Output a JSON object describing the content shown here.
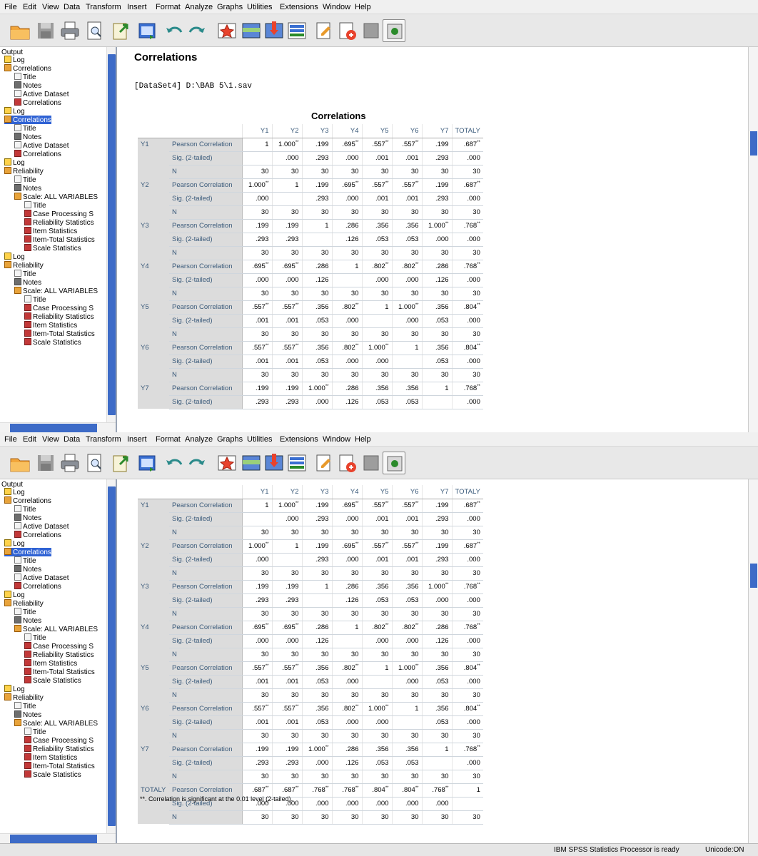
{
  "menu": [
    "File",
    "Edit",
    "View",
    "Data",
    "Transform",
    "Insert",
    "Format",
    "Analyze",
    "Graphs",
    "Utilities",
    "Extensions",
    "Window",
    "Help"
  ],
  "toolbar_icons": [
    "open-icon",
    "save-icon",
    "print-icon",
    "print-preview-icon",
    "export-icon",
    "recall-dialog-icon",
    "undo-icon",
    "redo-icon",
    "goto-data-icon",
    "goto-case-icon",
    "goto-variable-icon",
    "variables-icon",
    "insert-output-icon",
    "designate-window-icon",
    "hide-icon",
    "show-icon"
  ],
  "nav": {
    "root": "Output",
    "items": [
      {
        "label": "Log",
        "icon": "book",
        "level": 0
      },
      {
        "label": "Correlations",
        "icon": "folder",
        "level": 0
      },
      {
        "label": "Title",
        "icon": "doc",
        "level": 1
      },
      {
        "label": "Notes",
        "icon": "notes",
        "level": 1
      },
      {
        "label": "Active Dataset",
        "icon": "doc",
        "level": 1
      },
      {
        "label": "Correlations",
        "icon": "table",
        "level": 1
      },
      {
        "label": "Log",
        "icon": "book",
        "level": 0
      },
      {
        "label": "Correlations",
        "icon": "folder",
        "level": 0,
        "selected": true
      },
      {
        "label": "Title",
        "icon": "doc",
        "level": 1
      },
      {
        "label": "Notes",
        "icon": "notes",
        "level": 1
      },
      {
        "label": "Active Dataset",
        "icon": "doc",
        "level": 1
      },
      {
        "label": "Correlations",
        "icon": "table",
        "level": 1
      },
      {
        "label": "Log",
        "icon": "book",
        "level": 0
      },
      {
        "label": "Reliability",
        "icon": "folder",
        "level": 0
      },
      {
        "label": "Title",
        "icon": "doc",
        "level": 1
      },
      {
        "label": "Notes",
        "icon": "notes",
        "level": 1
      },
      {
        "label": "Scale: ALL VARIABLES",
        "icon": "folder",
        "level": 1
      },
      {
        "label": "Title",
        "icon": "doc",
        "level": 2
      },
      {
        "label": "Case Processing S",
        "icon": "table",
        "level": 2
      },
      {
        "label": "Reliability Statistics",
        "icon": "table",
        "level": 2
      },
      {
        "label": "Item Statistics",
        "icon": "table",
        "level": 2
      },
      {
        "label": "Item-Total Statistics",
        "icon": "table",
        "level": 2
      },
      {
        "label": "Scale Statistics",
        "icon": "table",
        "level": 2
      },
      {
        "label": "Log",
        "icon": "book",
        "level": 0
      },
      {
        "label": "Reliability",
        "icon": "folder",
        "level": 0
      },
      {
        "label": "Title",
        "icon": "doc",
        "level": 1
      },
      {
        "label": "Notes",
        "icon": "notes",
        "level": 1
      },
      {
        "label": "Scale: ALL VARIABLES",
        "icon": "folder",
        "level": 1
      },
      {
        "label": "Title",
        "icon": "doc",
        "level": 2
      },
      {
        "label": "Case Processing S",
        "icon": "table",
        "level": 2
      },
      {
        "label": "Reliability Statistics",
        "icon": "table",
        "level": 2
      },
      {
        "label": "Item Statistics",
        "icon": "table",
        "level": 2
      },
      {
        "label": "Item-Total Statistics",
        "icon": "table",
        "level": 2
      },
      {
        "label": "Scale Statistics",
        "icon": "table",
        "level": 2
      }
    ]
  },
  "output": {
    "heading": "Correlations",
    "dataset_line": "[DataSet4] D:\\BAB 5\\1.sav",
    "table_title": "Correlations",
    "columns": [
      "Y1",
      "Y2",
      "Y3",
      "Y4",
      "Y5",
      "Y6",
      "Y7",
      "TOTALY"
    ],
    "stat_labels": [
      "Pearson Correlation",
      "Sig. (2-tailed)",
      "N"
    ],
    "rows": [
      {
        "var": "Y1",
        "r": [
          "1",
          "1.000**",
          ".199",
          ".695**",
          ".557**",
          ".557**",
          ".199",
          ".687**"
        ],
        "sig": [
          "",
          ".000",
          ".293",
          ".000",
          ".001",
          ".001",
          ".293",
          ".000"
        ],
        "n": [
          "30",
          "30",
          "30",
          "30",
          "30",
          "30",
          "30",
          "30"
        ]
      },
      {
        "var": "Y2",
        "r": [
          "1.000**",
          "1",
          ".199",
          ".695**",
          ".557**",
          ".557**",
          ".199",
          ".687**"
        ],
        "sig": [
          ".000",
          "",
          ".293",
          ".000",
          ".001",
          ".001",
          ".293",
          ".000"
        ],
        "n": [
          "30",
          "30",
          "30",
          "30",
          "30",
          "30",
          "30",
          "30"
        ]
      },
      {
        "var": "Y3",
        "r": [
          ".199",
          ".199",
          "1",
          ".286",
          ".356",
          ".356",
          "1.000**",
          ".768**"
        ],
        "sig": [
          ".293",
          ".293",
          "",
          ".126",
          ".053",
          ".053",
          ".000",
          ".000"
        ],
        "n": [
          "30",
          "30",
          "30",
          "30",
          "30",
          "30",
          "30",
          "30"
        ]
      },
      {
        "var": "Y4",
        "r": [
          ".695**",
          ".695**",
          ".286",
          "1",
          ".802**",
          ".802**",
          ".286",
          ".768**"
        ],
        "sig": [
          ".000",
          ".000",
          ".126",
          "",
          ".000",
          ".000",
          ".126",
          ".000"
        ],
        "n": [
          "30",
          "30",
          "30",
          "30",
          "30",
          "30",
          "30",
          "30"
        ]
      },
      {
        "var": "Y5",
        "r": [
          ".557**",
          ".557**",
          ".356",
          ".802**",
          "1",
          "1.000**",
          ".356",
          ".804**"
        ],
        "sig": [
          ".001",
          ".001",
          ".053",
          ".000",
          "",
          ".000",
          ".053",
          ".000"
        ],
        "n": [
          "30",
          "30",
          "30",
          "30",
          "30",
          "30",
          "30",
          "30"
        ]
      },
      {
        "var": "Y6",
        "r": [
          ".557**",
          ".557**",
          ".356",
          ".802**",
          "1.000**",
          "1",
          ".356",
          ".804**"
        ],
        "sig": [
          ".001",
          ".001",
          ".053",
          ".000",
          ".000",
          "",
          ".053",
          ".000"
        ],
        "n": [
          "30",
          "30",
          "30",
          "30",
          "30",
          "30",
          "30",
          "30"
        ]
      },
      {
        "var": "Y7",
        "r": [
          ".199",
          ".199",
          "1.000**",
          ".286",
          ".356",
          ".356",
          "1",
          ".768**"
        ],
        "sig": [
          ".293",
          ".293",
          ".000",
          ".126",
          ".053",
          ".053",
          "",
          ".000"
        ],
        "n": [
          "30",
          "30",
          "30",
          "30",
          "30",
          "30",
          "30",
          "30"
        ]
      },
      {
        "var": "TOTALY",
        "r": [
          ".687**",
          ".687**",
          ".768**",
          ".768**",
          ".804**",
          ".804**",
          ".768**",
          "1"
        ],
        "sig": [
          ".000",
          ".000",
          ".000",
          ".000",
          ".000",
          ".000",
          ".000",
          ""
        ],
        "n": [
          "30",
          "30",
          "30",
          "30",
          "30",
          "30",
          "30",
          "30"
        ]
      }
    ],
    "footnote": "**. Correlation is significant at the 0.01 level (2-tailed)."
  },
  "status": {
    "processor": "IBM SPSS Statistics Processor is ready",
    "unicode": "Unicode:ON"
  },
  "colors": {
    "selection": "#2f62d4",
    "scroll_thumb": "#3d6bc7",
    "label_cell": "#dcdcdc",
    "label_text": "#3a5a7a"
  }
}
